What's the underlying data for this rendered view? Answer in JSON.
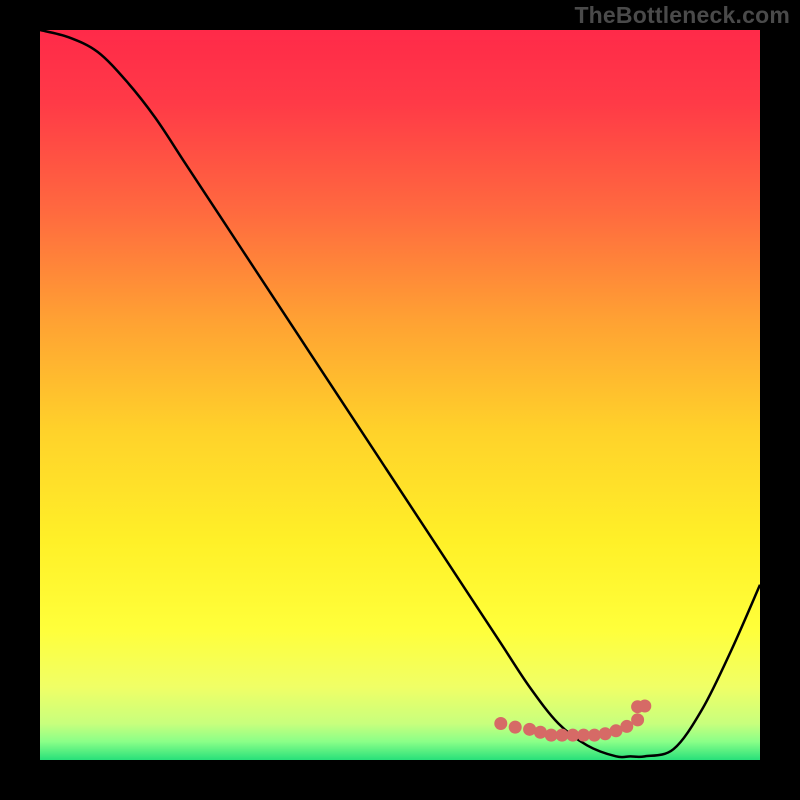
{
  "watermark": "TheBottleneck.com",
  "chart_data": {
    "type": "line",
    "title": "",
    "xlabel": "",
    "ylabel": "",
    "x_range": [
      0,
      100
    ],
    "y_range": [
      0,
      100
    ],
    "series": [
      {
        "name": "curve",
        "color": "#000000",
        "x": [
          0,
          4,
          8,
          12,
          16,
          20,
          24,
          28,
          32,
          36,
          40,
          44,
          48,
          52,
          56,
          60,
          64,
          68,
          72,
          76,
          80,
          82,
          84,
          88,
          92,
          96,
          100
        ],
        "y": [
          100,
          99,
          97,
          93,
          88,
          82,
          76,
          70,
          64,
          58,
          52,
          46,
          40,
          34,
          28,
          22,
          16,
          10,
          5,
          2,
          0.5,
          0.5,
          0.5,
          1.5,
          7,
          15,
          24
        ]
      },
      {
        "name": "highlight-dots",
        "color": "#d66a66",
        "x": [
          64,
          66,
          68,
          69.5,
          71,
          72.5,
          74,
          75.5,
          77,
          78.5,
          80,
          81.5,
          83,
          83,
          84
        ],
        "y": [
          5.0,
          4.5,
          4.2,
          3.8,
          3.4,
          3.4,
          3.4,
          3.4,
          3.4,
          3.6,
          4.0,
          4.6,
          5.5,
          7.3,
          7.4
        ]
      }
    ],
    "background": {
      "type": "vertical-gradient",
      "stops": [
        {
          "offset": 0.0,
          "color": "#ff2a49"
        },
        {
          "offset": 0.1,
          "color": "#ff3a47"
        },
        {
          "offset": 0.25,
          "color": "#ff6a3f"
        },
        {
          "offset": 0.4,
          "color": "#ffa233"
        },
        {
          "offset": 0.55,
          "color": "#ffd22a"
        },
        {
          "offset": 0.7,
          "color": "#fff028"
        },
        {
          "offset": 0.82,
          "color": "#ffff3a"
        },
        {
          "offset": 0.9,
          "color": "#f0ff66"
        },
        {
          "offset": 0.95,
          "color": "#c8ff7d"
        },
        {
          "offset": 0.975,
          "color": "#8aff88"
        },
        {
          "offset": 1.0,
          "color": "#28e07a"
        }
      ]
    }
  }
}
